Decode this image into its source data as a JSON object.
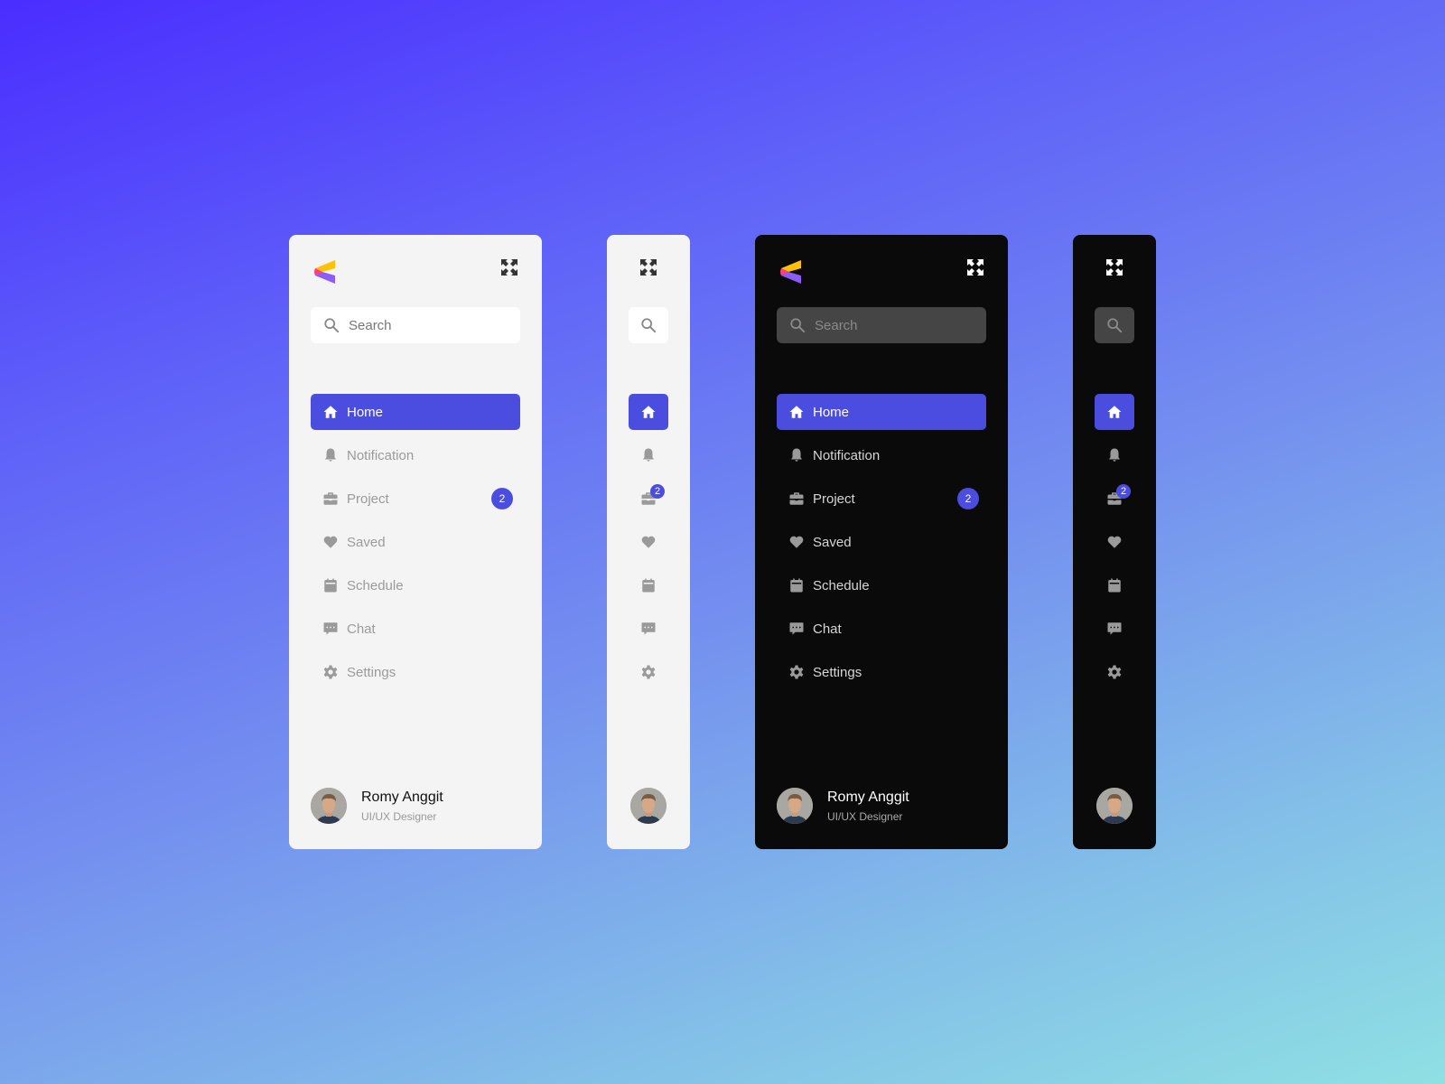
{
  "colors": {
    "accent": "#4b4ddf",
    "light_bg": "#f4f4f4",
    "dark_bg": "#0a0a0a",
    "icon_gray": "#9a9a9a",
    "logo_yellow": "#ffc107",
    "logo_pink": "#ff3d7f",
    "logo_purple": "#8b5cf6"
  },
  "search": {
    "placeholder": "Search",
    "icon": "search-icon"
  },
  "expand_icon": "expand-icon",
  "nav": [
    {
      "label": "Home",
      "icon": "home-icon",
      "active": true
    },
    {
      "label": "Notification",
      "icon": "bell-icon"
    },
    {
      "label": "Project",
      "icon": "briefcase-icon",
      "badge": "2"
    },
    {
      "label": "Saved",
      "icon": "heart-icon"
    },
    {
      "label": "Schedule",
      "icon": "calendar-icon"
    },
    {
      "label": "Chat",
      "icon": "chat-icon"
    },
    {
      "label": "Settings",
      "icon": "gear-icon"
    }
  ],
  "profile": {
    "name": "Romy Anggit",
    "role": "UI/UX Designer"
  },
  "variants": [
    "light-expanded",
    "light-collapsed",
    "dark-expanded",
    "dark-collapsed"
  ]
}
